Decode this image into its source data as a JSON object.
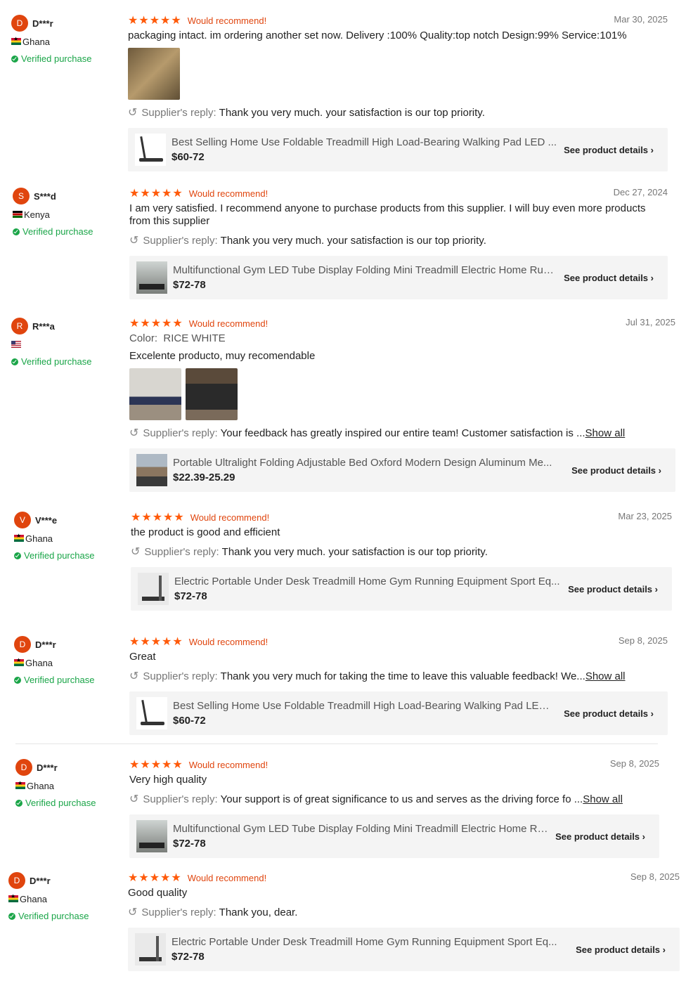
{
  "common": {
    "recommend": "Would recommend!",
    "verified": "Verified purchase",
    "reply_label": "Supplier's reply:",
    "see_details": "See product details",
    "stars": "★★★★★",
    "show_all": "Show all"
  },
  "reviews": [
    {
      "initial": "D",
      "name": "D***r",
      "country": "Ghana",
      "date": "Mar 30, 2025",
      "text": "packaging intact. im ordering another set now. Delivery :100% Quality:top notch Design:99% Service:101%",
      "reply": "Thank you very much. your satisfaction is our top priority.",
      "product": {
        "title": "Best Selling Home Use Foldable Treadmill High Load-Bearing Walking Pad LED ...",
        "price": "$60-72"
      }
    },
    {
      "initial": "S",
      "name": "S***d",
      "country": "Kenya",
      "date": "Dec 27, 2024",
      "text": "I am very satisfied. I recommend anyone to purchase products from this supplier. I will buy even more products from this supplier",
      "reply": "Thank you very much. your satisfaction is our top priority.",
      "product": {
        "title": "Multifunctional Gym LED Tube Display Folding Mini Treadmill Electric Home Run...",
        "price": "$72-78"
      }
    },
    {
      "initial": "R",
      "name": "R***a",
      "country": "",
      "date": "Jul 31, 2025",
      "color_label": "Color:",
      "color_value": "RICE WHITE",
      "text": "Excelente producto, muy recomendable",
      "reply": "Your feedback has greatly inspired our entire team! Customer satisfaction is ...",
      "product": {
        "title": "Portable Ultralight Folding Adjustable Bed Oxford Modern Design Aluminum Me...",
        "price": "$22.39-25.29"
      }
    },
    {
      "initial": "V",
      "name": "V***e",
      "country": "Ghana",
      "date": "Mar 23, 2025",
      "text": "the product is good and efficient",
      "reply": "Thank you very much. your satisfaction is our top priority.",
      "product": {
        "title": "Electric Portable Under Desk Treadmill Home Gym Running Equipment Sport Eq...",
        "price": "$72-78"
      }
    },
    {
      "initial": "D",
      "name": "D***r",
      "country": "Ghana",
      "date": "Sep 8, 2025",
      "text": "Great",
      "reply": "Thank you very much for taking the time to leave this valuable feedback! We...",
      "product": {
        "title": "Best Selling Home Use Foldable Treadmill High Load-Bearing Walking Pad LED ...",
        "price": "$60-72"
      }
    },
    {
      "initial": "D",
      "name": "D***r",
      "country": "Ghana",
      "date": "Sep 8, 2025",
      "text": "Very high quality",
      "reply": "Your support is of great significance to us and serves as the driving force fo ...",
      "product": {
        "title": "Multifunctional Gym LED Tube Display Folding Mini Treadmill Electric Home Run...",
        "price": "$72-78"
      }
    },
    {
      "initial": "D",
      "name": "D***r",
      "country": "Ghana",
      "date": "Sep 8, 2025",
      "text": "Good quality",
      "reply": "Thank you, dear.",
      "product": {
        "title": "Electric Portable Under Desk Treadmill Home Gym Running Equipment Sport Eq...",
        "price": "$72-78"
      }
    }
  ]
}
